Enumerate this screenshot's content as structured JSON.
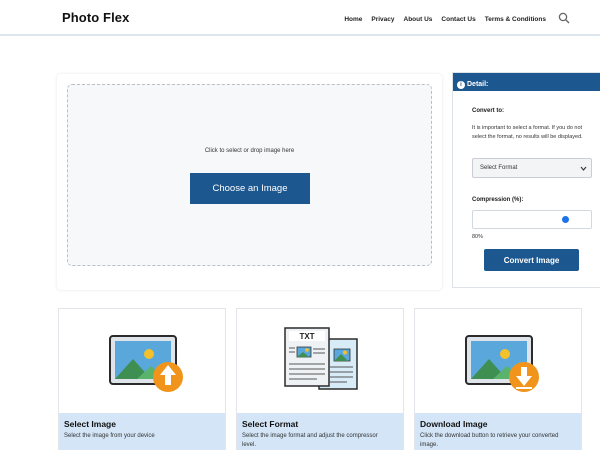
{
  "header": {
    "logo": "Photo Flex",
    "nav": [
      "Home",
      "Privacy",
      "About Us",
      "Contact Us",
      "Terms & Conditions"
    ],
    "search_icon": "search-icon"
  },
  "upload": {
    "hint": "Click to select or drop image here",
    "button": "Choose an Image"
  },
  "detail": {
    "title": "Detail:",
    "info_icon": "info-icon",
    "convert_label": "Convert to:",
    "convert_note": "It is important to select a format. If you do not select the format, no results will be displayed.",
    "format_selected": "Select Format",
    "compression_label": "Compression (%):",
    "compression_value": "80%",
    "compression_level": 0.8,
    "convert_button": "Convert Image"
  },
  "features": [
    {
      "title": "Select Image",
      "desc": "Select the image from your device",
      "icon": "image-upload-icon"
    },
    {
      "title": "Select Format",
      "desc": "Select the image format and adjust the compressor level.",
      "icon": "txt-document-icon"
    },
    {
      "title": "Download Image",
      "desc": "Click the download button to retrieve your converted image.",
      "icon": "image-download-icon"
    }
  ],
  "colors": {
    "primary": "#1d578f",
    "caption_bg": "#d3e5f6",
    "badge_orange": "#f0941c",
    "slider_blue": "#1a73e8"
  }
}
